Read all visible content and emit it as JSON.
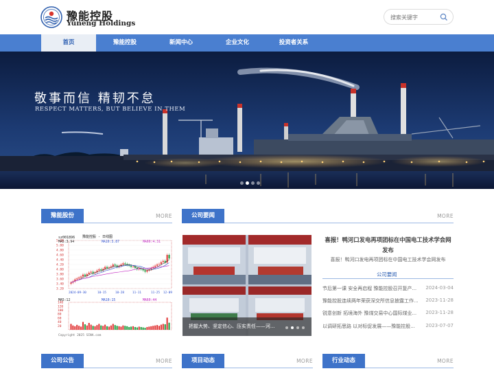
{
  "header": {
    "logo_cn": "豫能控股",
    "logo_en": "Yuneng Holdings",
    "search_placeholder": "搜索关键字"
  },
  "nav": {
    "items": [
      "首页",
      "豫能控股",
      "新闻中心",
      "企业文化",
      "投资者关系"
    ],
    "active_index": 0
  },
  "banner": {
    "slogan_cn": "敬事而信  精韧不怠",
    "slogan_en": "RESPECT MATTERS, BUT BELIEVE IN THEM",
    "dot_count": 4,
    "active_dot": 1
  },
  "sections": {
    "stock": {
      "title": "豫能股份",
      "more": "MORE"
    },
    "company_news": {
      "title": "公司要闻",
      "more": "MORE"
    },
    "announcement": {
      "title": "公司公告",
      "more": "MORE"
    },
    "project": {
      "title": "项目动态",
      "more": "MORE"
    },
    "industry": {
      "title": "行业动态",
      "more": "MORE"
    }
  },
  "stock_chart": {
    "code_line": "sz001896",
    "name_line": "豫能控股  - 日线图",
    "ma5": "MA5:3.94",
    "ma10": "MA10:3.87",
    "ma60": "MA60:4.31",
    "vol_ma5": "MA5:12",
    "vol_ma10": "MA10:15",
    "vol_ma60": "MA60:44",
    "price_ticks": [
      "5.20",
      "5.00",
      "4.80",
      "4.60",
      "4.40",
      "4.20",
      "4.00",
      "3.80",
      "3.60",
      "3.40",
      "3.20"
    ],
    "vol_ticks": [
      "140",
      "120",
      "100",
      "80",
      "60",
      "40",
      "20"
    ],
    "date_ticks": [
      "2024-09-30",
      "10-15",
      "10-28",
      "11-11",
      "11-25",
      "12-09"
    ],
    "copyright": "Copyright 2025 SINA.com",
    "chart_data": {
      "type": "candlestick",
      "title": "豫能控股  - 日线图",
      "ylim": [
        3.2,
        5.2
      ],
      "closes": [
        3.45,
        3.5,
        3.58,
        3.62,
        3.66,
        3.7,
        3.78,
        3.72,
        3.8,
        3.86,
        3.9,
        3.84,
        3.88,
        3.95,
        4.0,
        3.96,
        4.02,
        4.1,
        4.05,
        4.08,
        4.12,
        4.2,
        4.16,
        4.1,
        4.14,
        4.2,
        4.25,
        4.22,
        4.18,
        4.15,
        4.1,
        4.12,
        4.06,
        4.0,
        4.04,
        4.0,
        3.96,
        3.9,
        3.96,
        4.0,
        4.05,
        4.1,
        4.15,
        4.2,
        4.22,
        4.3,
        4.35,
        4.28,
        4.6,
        4.45
      ],
      "volumes": [
        30,
        22,
        18,
        25,
        20,
        16,
        40,
        28,
        22,
        35,
        26,
        20,
        18,
        24,
        30,
        22,
        20,
        26,
        18,
        16,
        22,
        30,
        24,
        20,
        18,
        16,
        22,
        20,
        18,
        14,
        16,
        18,
        14,
        12,
        16,
        14,
        12,
        10,
        14,
        16,
        18,
        20,
        22,
        24,
        20,
        26,
        30,
        28,
        62,
        36
      ]
    }
  },
  "company_news": {
    "photo_caption": "把握大势、坚定信心、压实责任——河...",
    "photo_dot_count": 4,
    "headline_title": "喜报！鸭河口发电再项团标在中国电工技术学会网发布",
    "headline_desc": "喜报！鸭河口发电再项团标在中国电工技术学会网发布",
    "notice_label": "公司要闻",
    "items": [
      {
        "title": "节后第一课 安全再启程 豫能控股召开复产...",
        "date": "2024-03-04"
      },
      {
        "title": "豫能控股连续两年荣获深交所信息披露工作...",
        "date": "2023-11-28"
      },
      {
        "title": "锐意创新 拓境海外 豫煤交易中心国际煤业...",
        "date": "2023-11-28"
      },
      {
        "title": "以调研拓思路 以对标促发展——豫能控股...",
        "date": "2023-07-07"
      }
    ]
  },
  "colors": {
    "nav_blue": "#4a7fd0",
    "tab_blue": "#3e73c9",
    "nav_active_text": "#2f61b3"
  }
}
